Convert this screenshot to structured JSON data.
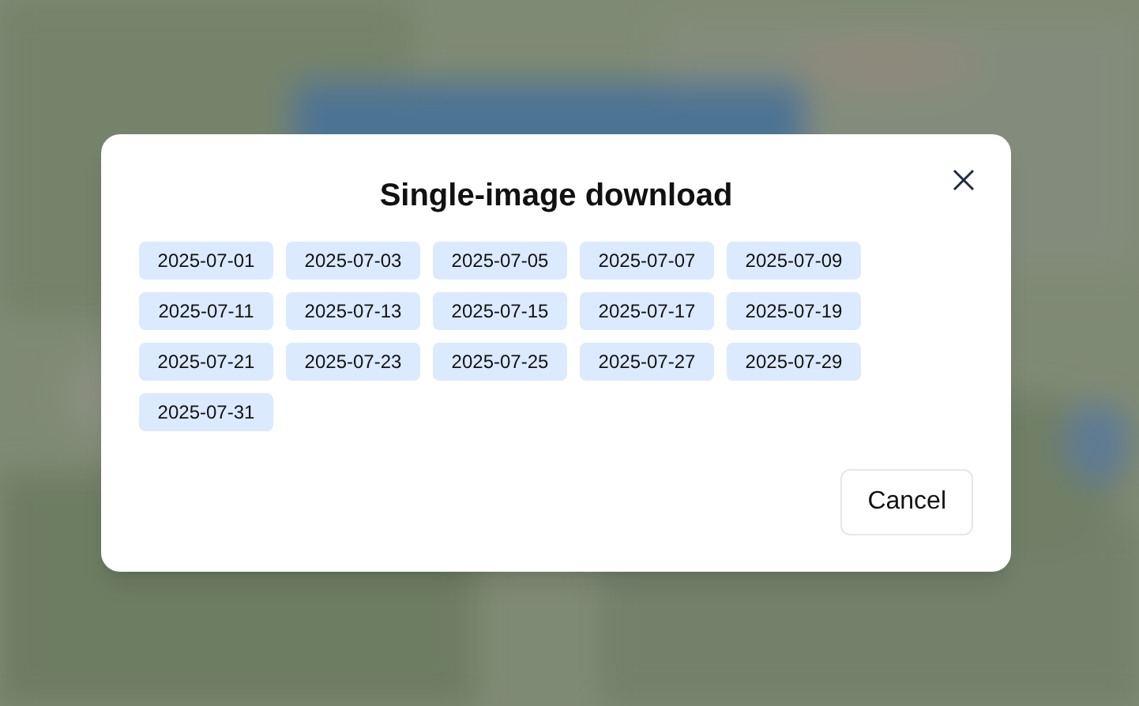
{
  "dialog": {
    "title": "Single-image download",
    "dates": [
      "2025-07-01",
      "2025-07-03",
      "2025-07-05",
      "2025-07-07",
      "2025-07-09",
      "2025-07-11",
      "2025-07-13",
      "2025-07-15",
      "2025-07-17",
      "2025-07-19",
      "2025-07-21",
      "2025-07-23",
      "2025-07-25",
      "2025-07-27",
      "2025-07-29",
      "2025-07-31"
    ],
    "buttons": [
      "Cancel"
    ]
  }
}
